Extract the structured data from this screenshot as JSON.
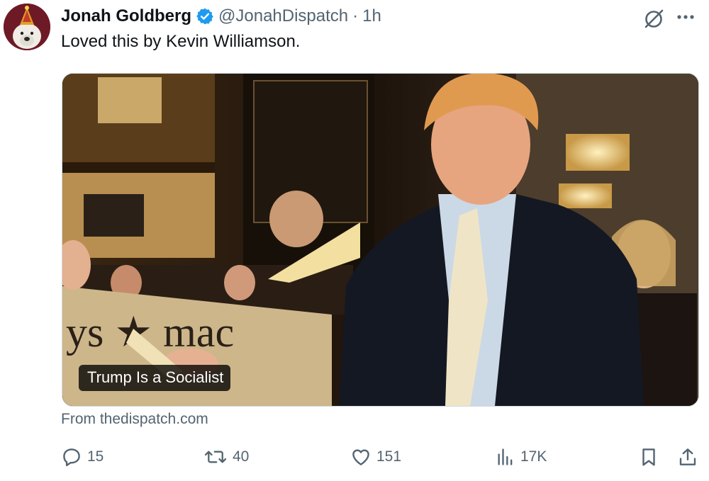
{
  "author": {
    "name": "Jonah Goldberg",
    "handle": "@JonahDispatch",
    "separator": "·",
    "time": "1h",
    "avatar_icon": "dog-avatar-icon",
    "verified_icon": "verified-badge-icon"
  },
  "tweet": {
    "text": "Loved this by Kevin Williamson."
  },
  "card": {
    "title": "Trump Is a Socialist",
    "source": "From thedispatch.com",
    "banner_text": "ys ★ mac"
  },
  "actions": {
    "replies": "15",
    "reposts": "40",
    "likes": "151",
    "views": "17K"
  },
  "colors": {
    "text": "#0f1419",
    "secondary": "#536471",
    "verified": "#1d9bf0",
    "card_border": "#cfd9de"
  }
}
